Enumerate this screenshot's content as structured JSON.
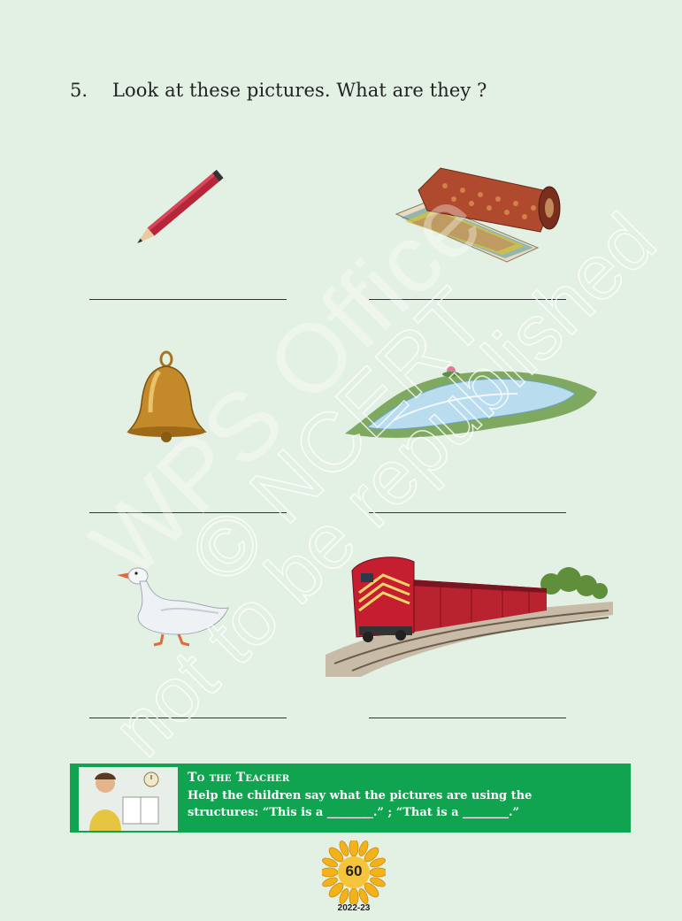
{
  "question": {
    "number": "5.",
    "text": "Look at these pictures. What are they ?"
  },
  "pictures": [
    {
      "name": "pencil-icon"
    },
    {
      "name": "mat-icon"
    },
    {
      "name": "bell-icon"
    },
    {
      "name": "pond-icon"
    },
    {
      "name": "duck-icon"
    },
    {
      "name": "train-icon"
    }
  ],
  "watermark": {
    "line1": "WPS Office",
    "line2": "© NCERT",
    "line3": "not to be republished"
  },
  "teacher_box": {
    "title": "To the Teacher",
    "body": "Help the children say what the pictures are using the structures: “This is a ________.” ; “That is a ________.”"
  },
  "footer": {
    "page_number": "60",
    "year": "2022-23"
  },
  "colors": {
    "page_bg": "#e3f0e4",
    "teacher_bg": "#10a450"
  }
}
